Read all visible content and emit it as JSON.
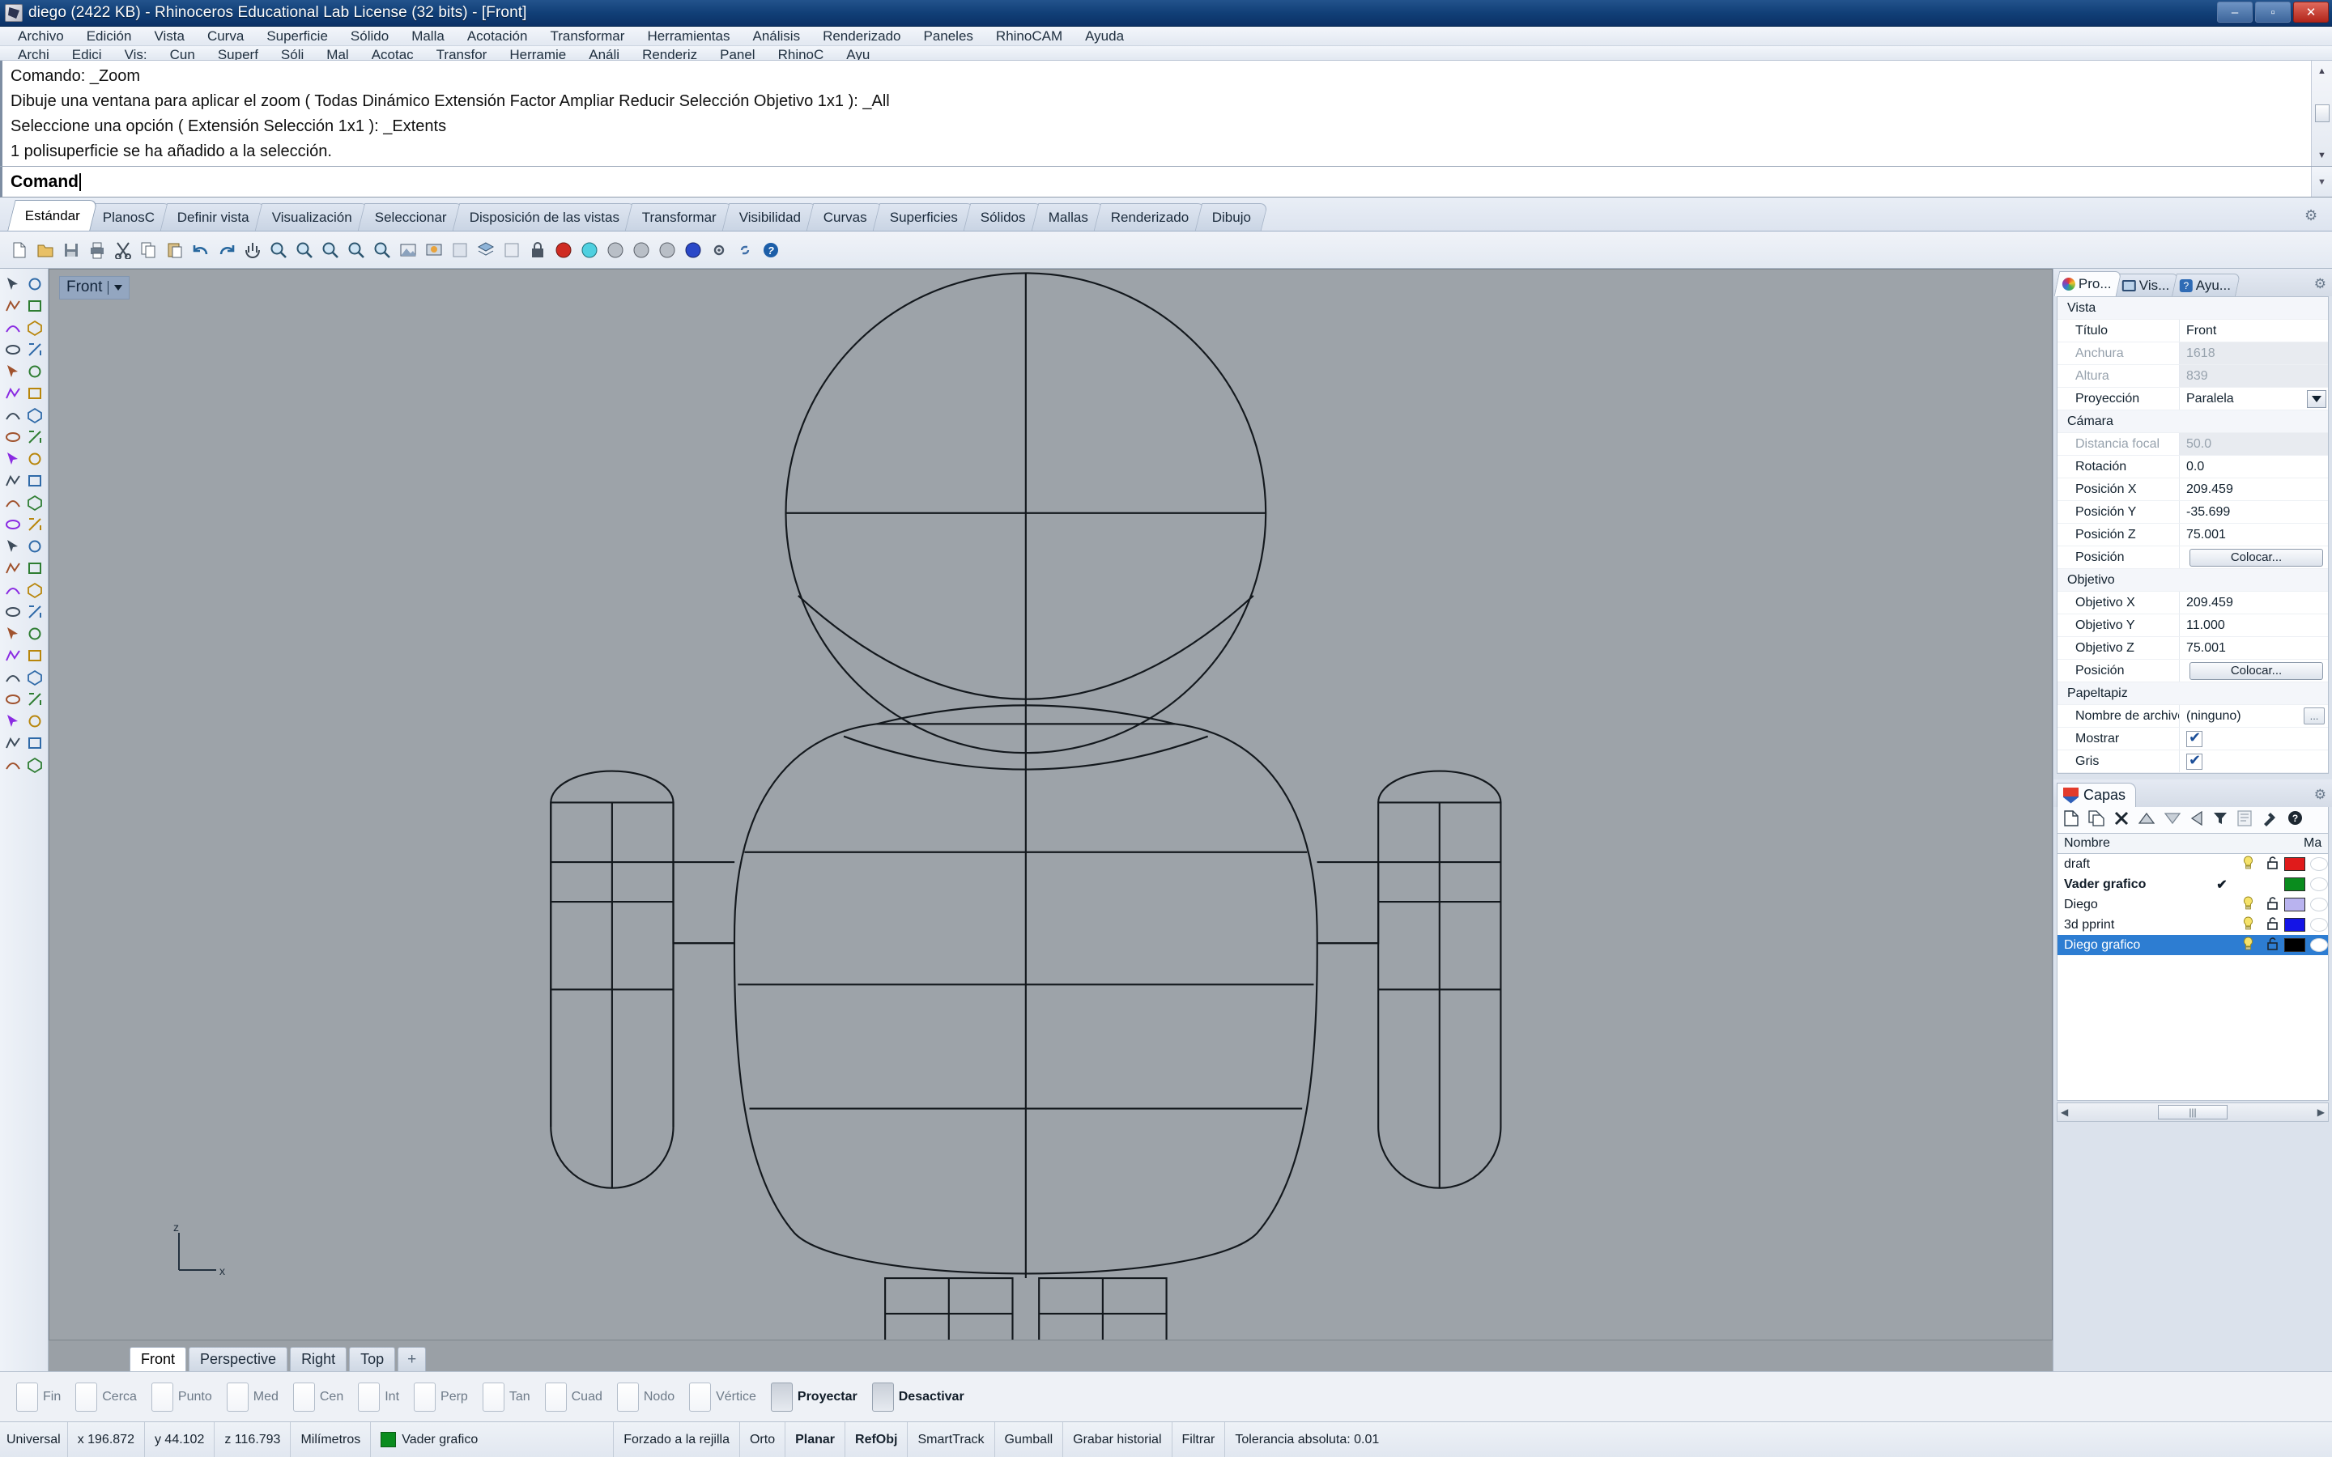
{
  "window": {
    "title": "diego (2422 KB) - Rhinoceros Educational Lab License (32 bits) - [Front]",
    "minimize": "–",
    "maximize": "▫",
    "close": "✕"
  },
  "menubar": {
    "items": [
      "Archivo",
      "Edición",
      "Vista",
      "Curva",
      "Superficie",
      "Sólido",
      "Malla",
      "Acotación",
      "Transformar",
      "Herramientas",
      "Análisis",
      "Renderizado",
      "Paneles",
      "RhinoCAM",
      "Ayuda"
    ],
    "clipped_items": [
      "Archi",
      "Edici",
      "Vis:",
      "Cun",
      "Superf",
      "Sóli",
      "Mal",
      "Acotac",
      "Transfor",
      "Herramie",
      "Análi",
      "Renderiz",
      "Panel",
      "RhinoC",
      "Ayu"
    ]
  },
  "command": {
    "history": [
      "Comando: _Zoom",
      "Dibuje una ventana para aplicar el zoom ( Todas  Dinámico  Extensión  Factor  Ampliar  Reducir  Selección  Objetivo  1x1 ): _All",
      "Seleccione una opción ( Extensión  Selección  1x1 ): _Extents",
      "1 polisuperficie se ha añadido a la selección."
    ],
    "prompt": "Comand",
    "scroll_up": "▲",
    "scroll_down": "▼"
  },
  "tool_tabs": {
    "items": [
      "Estándar",
      "PlanosC",
      "Definir vista",
      "Visualización",
      "Seleccionar",
      "Disposición de las vistas",
      "Transformar",
      "Visibilidad",
      "Curvas",
      "Superficies",
      "Sólidos",
      "Mallas",
      "Renderizado",
      "Dibujo"
    ],
    "active": "Estándar",
    "gear_icon": "gear-icon"
  },
  "toolbar_icons": [
    "new-file-icon",
    "open-folder-icon",
    "save-icon",
    "print-icon",
    "cut-icon",
    "copy-icon",
    "paste-icon",
    "undo-icon",
    "redo-icon",
    "pan-icon",
    "zoom-window-icon",
    "zoom-extents-icon",
    "zoom-selected-icon",
    "zoom-dynamic-icon",
    "zoom-target-icon",
    "shaded-view-icon",
    "render-icon",
    "named-views-icon",
    "layers-icon",
    "properties-icon",
    "lock-icon",
    "object-red-icon",
    "object-cyan-icon",
    "object-gray1-icon",
    "object-gray2-icon",
    "object-gray3-icon",
    "object-blue-icon",
    "gear-tools-icon",
    "link-icon",
    "help-icon"
  ],
  "viewport": {
    "label": "Front",
    "dropdown_icon": "chevron-down-icon",
    "axis_z": "z",
    "axis_x": "x",
    "background_color": "#9da3a9",
    "tabs": [
      "Front",
      "Perspective",
      "Right",
      "Top"
    ],
    "active_tab": "Front",
    "add_tab": "+"
  },
  "properties_panel": {
    "tabs": [
      {
        "label": "Pro...",
        "icon": "color-wheel-icon",
        "active": true
      },
      {
        "label": "Vis...",
        "icon": "monitor-icon",
        "active": false
      },
      {
        "label": "Ayu...",
        "icon": "help-icon",
        "active": false
      }
    ],
    "gear_icon": "gear-icon",
    "rows": [
      {
        "type": "group",
        "key": "Vista"
      },
      {
        "type": "text",
        "key": "Título",
        "value": "Front"
      },
      {
        "type": "text",
        "key": "Anchura",
        "value": "1618",
        "dim": true
      },
      {
        "type": "text",
        "key": "Altura",
        "value": "839",
        "dim": true
      },
      {
        "type": "dropdown",
        "key": "Proyección",
        "value": "Paralela"
      },
      {
        "type": "group",
        "key": "Cámara"
      },
      {
        "type": "text",
        "key": "Distancia focal",
        "value": "50.0",
        "dim": true
      },
      {
        "type": "text",
        "key": "Rotación",
        "value": "0.0"
      },
      {
        "type": "text",
        "key": "Posición X",
        "value": "209.459"
      },
      {
        "type": "text",
        "key": "Posición Y",
        "value": "-35.699"
      },
      {
        "type": "text",
        "key": "Posición Z",
        "value": "75.001"
      },
      {
        "type": "button",
        "key": "Posición",
        "value": "Colocar..."
      },
      {
        "type": "group",
        "key": "Objetivo"
      },
      {
        "type": "text",
        "key": "Objetivo X",
        "value": "209.459"
      },
      {
        "type": "text",
        "key": "Objetivo Y",
        "value": "11.000"
      },
      {
        "type": "text",
        "key": "Objetivo Z",
        "value": "75.001"
      },
      {
        "type": "button",
        "key": "Posición",
        "value": "Colocar..."
      },
      {
        "type": "group",
        "key": "Papeltapiz"
      },
      {
        "type": "file",
        "key": "Nombre de archivo",
        "value": "(ninguno)",
        "browse": "..."
      },
      {
        "type": "check",
        "key": "Mostrar",
        "value": ""
      },
      {
        "type": "check",
        "key": "Gris",
        "value": ""
      }
    ]
  },
  "layers_panel": {
    "title": "Capas",
    "shield_icon": "rhino-layer-icon",
    "gear_icon": "gear-icon",
    "toolbar_icons": [
      "new-layer-icon",
      "duplicate-layer-icon",
      "delete-layer-icon",
      "move-up-icon",
      "move-down-icon",
      "move-left-icon",
      "filter-icon",
      "properties-layer-icon",
      "tools-hammer-icon",
      "help-icon"
    ],
    "columns": [
      "Nombre",
      "Ma"
    ],
    "rows": [
      {
        "name": "draft",
        "current": "",
        "bulb": "on",
        "lock": "unlocked",
        "color": "#e01b1b",
        "material": "#ffffff",
        "selected": false,
        "bold": false
      },
      {
        "name": "Vader grafico",
        "current": "✔",
        "bulb": "",
        "lock": "",
        "color": "#0a8c1e",
        "material": "#ffffff",
        "selected": false,
        "bold": true
      },
      {
        "name": "Diego",
        "current": "",
        "bulb": "on",
        "lock": "unlocked",
        "color": "#b9b3ef",
        "material": "#ffffff",
        "selected": false,
        "bold": false
      },
      {
        "name": "3d pprint",
        "current": "",
        "bulb": "on",
        "lock": "unlocked",
        "color": "#1414e6",
        "material": "#ffffff",
        "selected": false,
        "bold": false
      },
      {
        "name": "Diego grafico",
        "current": "",
        "bulb": "on",
        "lock": "unlocked",
        "color": "#000000",
        "material": "#ffffff",
        "selected": true,
        "bold": false
      }
    ],
    "scroll_left": "◀",
    "scroll_right": "▶",
    "scroll_grip": "|||"
  },
  "osnap": {
    "items": [
      {
        "label": "Fin",
        "on": false
      },
      {
        "label": "Cerca",
        "on": false
      },
      {
        "label": "Punto",
        "on": false
      },
      {
        "label": "Med",
        "on": false
      },
      {
        "label": "Cen",
        "on": false
      },
      {
        "label": "Int",
        "on": false
      },
      {
        "label": "Perp",
        "on": false
      },
      {
        "label": "Tan",
        "on": false
      },
      {
        "label": "Cuad",
        "on": false
      },
      {
        "label": "Nodo",
        "on": false
      },
      {
        "label": "Vértice",
        "on": false
      },
      {
        "label": "Proyectar",
        "on": true
      },
      {
        "label": "Desactivar",
        "on": true
      }
    ]
  },
  "statusbar": {
    "cplane": "Universal",
    "x": "x 196.872",
    "y": "y 44.102",
    "z": "z 116.793",
    "units": "Milímetros",
    "layer": "Vader grafico",
    "layer_color": "#0a8c1e",
    "toggles": [
      {
        "label": "Forzado a la rejilla",
        "on": false
      },
      {
        "label": "Orto",
        "on": false
      },
      {
        "label": "Planar",
        "on": true
      },
      {
        "label": "RefObj",
        "on": true
      },
      {
        "label": "SmartTrack",
        "on": false
      },
      {
        "label": "Gumball",
        "on": false
      },
      {
        "label": "Grabar historial",
        "on": false
      },
      {
        "label": "Filtrar",
        "on": false
      }
    ],
    "tolerance": "Tolerancia absoluta: 0.01"
  }
}
